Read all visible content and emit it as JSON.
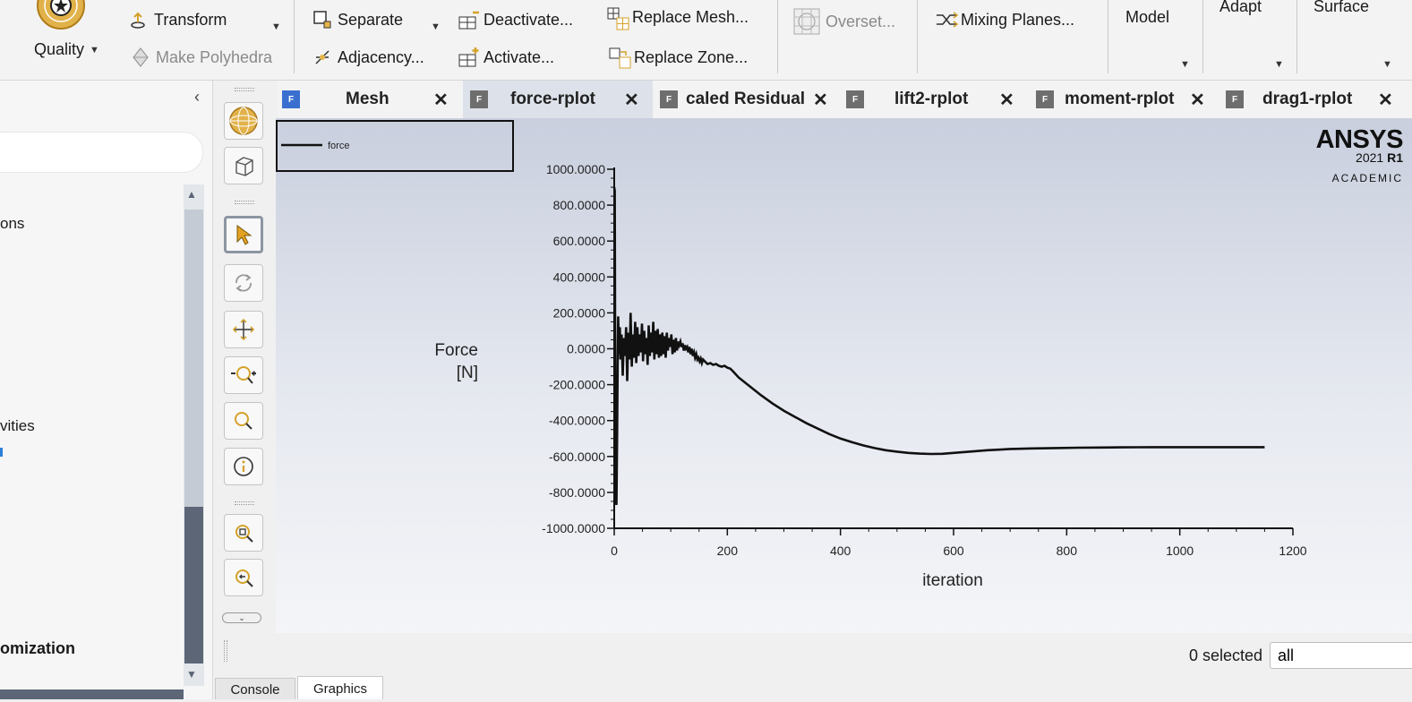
{
  "ribbon": {
    "quality_label": "Quality",
    "transform_label": "Transform",
    "make_polyhedra_label": "Make Polyhedra",
    "separate_label": "Separate",
    "adjacency_label": "Adjacency...",
    "deactivate_label": "Deactivate...",
    "activate_label": "Activate...",
    "replace_mesh_label": "Replace Mesh...",
    "replace_zone_label": "Replace Zone...",
    "overset_label": "Overset...",
    "mixing_planes_label": "Mixing Planes...",
    "model_label": "Model",
    "adapt_label": "Adapt",
    "surface_label": "Surface"
  },
  "sidebar": {
    "items": [
      {
        "label": "ons"
      },
      {
        "label": "vities"
      },
      {
        "label": "omization"
      }
    ]
  },
  "tabs": [
    {
      "label": "Mesh",
      "active": false
    },
    {
      "label": "force-rplot",
      "active": true
    },
    {
      "label": "caled Residual",
      "active": false
    },
    {
      "label": "lift2-rplot",
      "active": false
    },
    {
      "label": "moment-rplot",
      "active": false
    },
    {
      "label": "drag1-rplot",
      "active": false
    }
  ],
  "logo": {
    "brand": "ANSYS",
    "version": "2021",
    "release": "R1",
    "edition": "ACADEMIC"
  },
  "status": {
    "selected_text": "0 selected",
    "filter_value": "all"
  },
  "bottom_tabs": {
    "console": "Console",
    "graphics": "Graphics"
  },
  "chart_data": {
    "type": "line",
    "legend": [
      "force"
    ],
    "ylabel_line1": "Force",
    "ylabel_line2": "[N]",
    "xlabel": "iteration",
    "xlim": [
      0,
      1200
    ],
    "ylim": [
      -1000,
      1000
    ],
    "xticks": [
      "0",
      "200",
      "400",
      "600",
      "800",
      "1000",
      "1200"
    ],
    "yticks": [
      "1000.0000",
      "800.0000",
      "600.0000",
      "400.0000",
      "200.0000",
      "0.0000",
      "-200.0000",
      "-400.0000",
      "-600.0000",
      "-800.0000",
      "-1000.0000"
    ],
    "series": [
      {
        "name": "force",
        "x": [
          0,
          1,
          2,
          3,
          4,
          5,
          6,
          7,
          8,
          9,
          10,
          11,
          13,
          15,
          17,
          19,
          21,
          23,
          25,
          27,
          29,
          31,
          33,
          35,
          37,
          39,
          41,
          43,
          45,
          47,
          49,
          51,
          53,
          55,
          57,
          59,
          61,
          63,
          65,
          67,
          69,
          71,
          73,
          75,
          77,
          79,
          81,
          83,
          85,
          87,
          89,
          91,
          93,
          95,
          97,
          99,
          101,
          103,
          105,
          107,
          109,
          111,
          113,
          115,
          117,
          119,
          121,
          123,
          125,
          127,
          129,
          131,
          133,
          135,
          137,
          139,
          141,
          143,
          145,
          147,
          149,
          151,
          153,
          155,
          157,
          160,
          165,
          170,
          175,
          180,
          185,
          190,
          195,
          200,
          205,
          210,
          220,
          240,
          260,
          280,
          300,
          320,
          340,
          360,
          380,
          400,
          420,
          440,
          460,
          480,
          500,
          520,
          540,
          560,
          580,
          600,
          620,
          640,
          660,
          680,
          700,
          740,
          780,
          820,
          860,
          900,
          950,
          1000,
          1050,
          1100,
          1150
        ],
        "y": [
          900,
          880,
          -500,
          -850,
          -870,
          -500,
          -100,
          180,
          20,
          -30,
          120,
          -60,
          80,
          -150,
          60,
          -40,
          120,
          -180,
          90,
          -60,
          200,
          -100,
          80,
          -50,
          150,
          -80,
          120,
          -40,
          80,
          -20,
          140,
          -70,
          100,
          -30,
          60,
          -90,
          130,
          -40,
          90,
          -20,
          150,
          -60,
          100,
          -30,
          110,
          -50,
          80,
          -40,
          90,
          -30,
          70,
          -50,
          90,
          -10,
          60,
          10,
          80,
          -30,
          50,
          -20,
          60,
          -10,
          40,
          20,
          40,
          10,
          30,
          -10,
          20,
          0,
          10,
          -20,
          10,
          -30,
          0,
          -40,
          -20,
          -50,
          -30,
          -60,
          -50,
          -70,
          -55,
          -80,
          -60,
          -70,
          -85,
          -80,
          -90,
          -85,
          -95,
          -100,
          -95,
          -105,
          -110,
          -125,
          -160,
          -210,
          -260,
          -305,
          -345,
          -380,
          -415,
          -445,
          -475,
          -500,
          -520,
          -538,
          -553,
          -565,
          -573,
          -580,
          -584,
          -586,
          -585,
          -580,
          -575,
          -570,
          -565,
          -562,
          -558,
          -555,
          -553,
          -551,
          -550,
          -549,
          -548,
          -548,
          -548,
          -548,
          -548
        ]
      }
    ]
  }
}
